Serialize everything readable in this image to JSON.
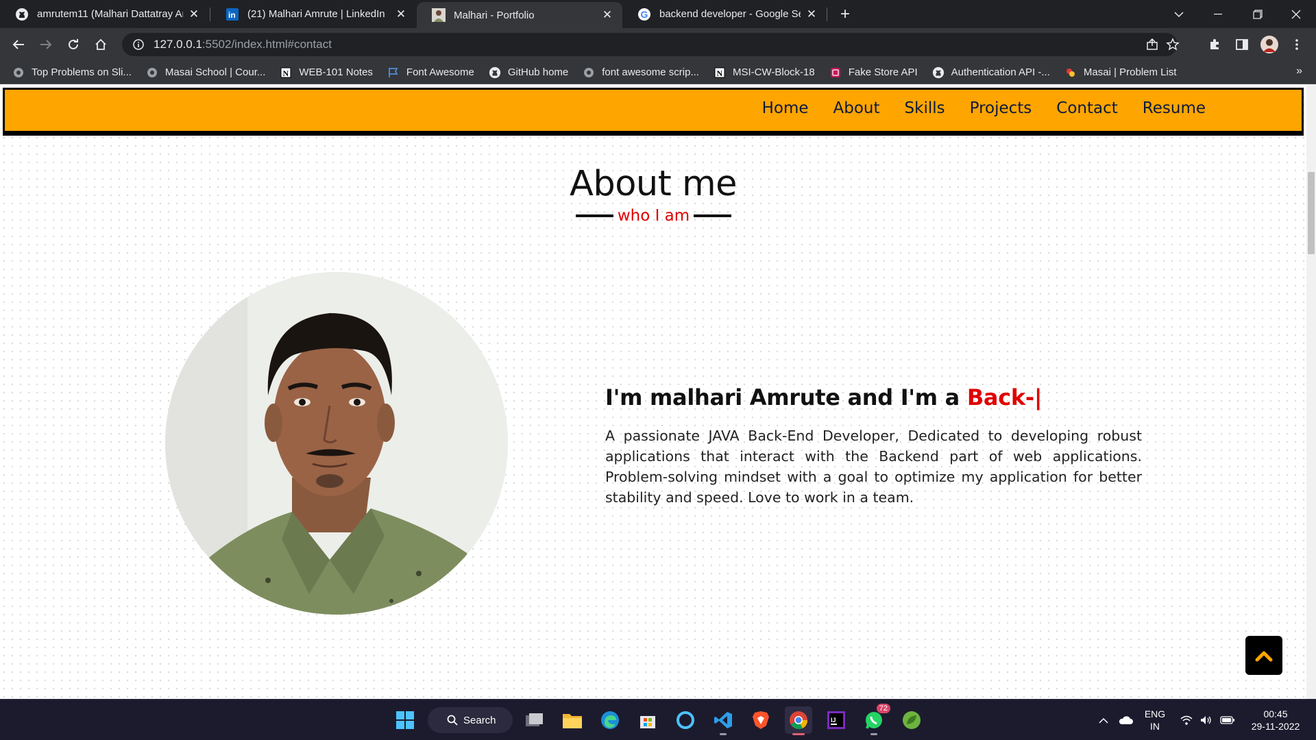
{
  "browser": {
    "tabs": [
      {
        "title": "amrutem11 (Malhari Dattatray Amrute)",
        "icon": "github-icon",
        "active": false
      },
      {
        "title": "(21) Malhari Amrute | LinkedIn",
        "icon": "linkedin-icon",
        "active": false
      },
      {
        "title": "Malhari - Portfolio",
        "icon": "portfolio-favicon-icon",
        "active": true
      },
      {
        "title": "backend developer - Google Search",
        "icon": "google-icon",
        "active": false
      }
    ],
    "url_host": "127.0.0.1",
    "url_rest": ":5502/index.html#contact",
    "bookmarks": [
      {
        "label": "Top Problems on Sli...",
        "icon": "globe-icon"
      },
      {
        "label": "Masai School | Cour...",
        "icon": "globe-icon"
      },
      {
        "label": "WEB-101 Notes",
        "icon": "notion-icon"
      },
      {
        "label": "Font Awesome",
        "icon": "flag-icon"
      },
      {
        "label": "GitHub home",
        "icon": "github-icon"
      },
      {
        "label": "font awesome scrip...",
        "icon": "globe-icon"
      },
      {
        "label": "MSI-CW-Block-18",
        "icon": "notion-icon"
      },
      {
        "label": "Fake Store API",
        "icon": "store-icon"
      },
      {
        "label": "Authentication API -...",
        "icon": "github-icon"
      },
      {
        "label": "Masai | Problem List",
        "icon": "masai-icon"
      }
    ],
    "bookmarks_more": "»"
  },
  "site": {
    "nav": [
      "Home",
      "About",
      "Skills",
      "Projects",
      "Contact",
      "Resume"
    ],
    "about_title": "About me",
    "about_subtitle": "who I am",
    "intro_prefix": "I'm malhari Amrute and I'm a ",
    "intro_typed": "Back-|",
    "bio": "A passionate JAVA Back-End Developer, Dedicated to developing robust applications that interact with the Backend part of web applications. Problem-solving mindset with a goal to optimize my application for better stability and speed. Love to work in a team."
  },
  "taskbar": {
    "search_label": "Search",
    "whatsapp_badge": "72",
    "language": "ENG",
    "region": "IN",
    "time": "00:45",
    "date": "29-11-2022"
  },
  "colors": {
    "navbar": "#ffa500",
    "accent_red": "#e00000",
    "chrome_dark": "#202124",
    "chrome_toolbar": "#35363a",
    "taskbar": "#1c1b2e"
  }
}
